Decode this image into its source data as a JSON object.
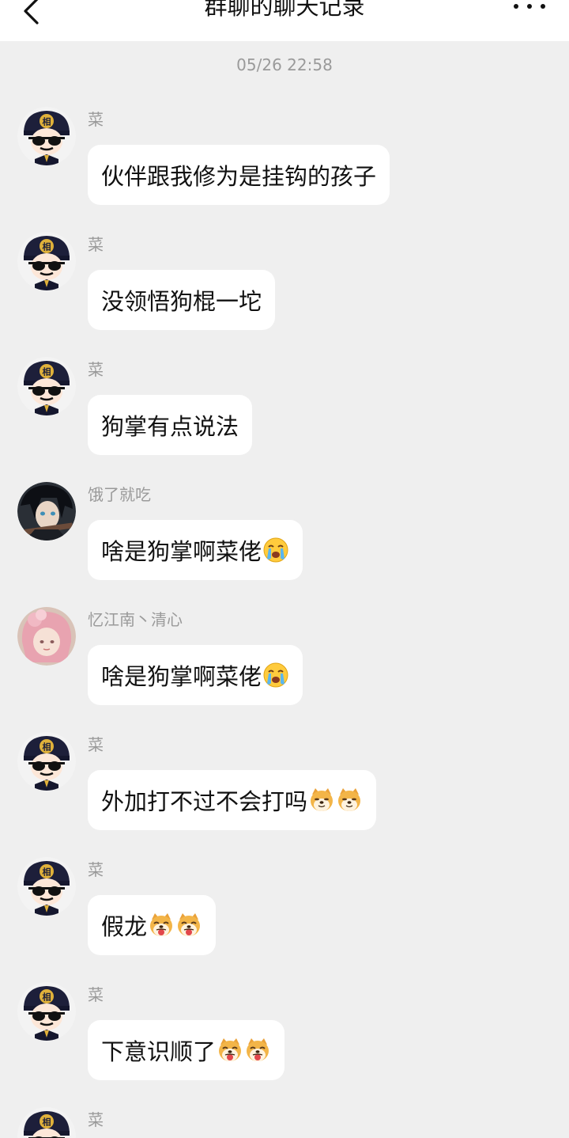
{
  "header": {
    "title": "群聊的聊天记录"
  },
  "timestamp": "05/26 22:58",
  "messages": [
    {
      "sender": "菜",
      "text": "伙伴跟我修为是挂钩的孩子",
      "avatar": "officer-avatar",
      "emojis": []
    },
    {
      "sender": "菜",
      "text": "没领悟狗棍一坨",
      "avatar": "officer-avatar",
      "emojis": []
    },
    {
      "sender": "菜",
      "text": "狗掌有点说法",
      "avatar": "officer-avatar",
      "emojis": []
    },
    {
      "sender": "饿了就吃",
      "text": "啥是狗掌啊菜佬",
      "avatar": "anime-dark-avatar",
      "emojis": [
        "crying-face-emoji"
      ]
    },
    {
      "sender": "忆江南丶清心",
      "text": "啥是狗掌啊菜佬",
      "avatar": "anime-pink-avatar",
      "emojis": [
        "crying-face-emoji"
      ]
    },
    {
      "sender": "菜",
      "text": "外加打不过不会打吗",
      "avatar": "officer-avatar",
      "emojis": [
        "doge-emoji",
        "doge-emoji"
      ]
    },
    {
      "sender": "菜",
      "text": "假龙",
      "avatar": "officer-avatar",
      "emojis": [
        "doge-tongue-emoji",
        "doge-tongue-emoji"
      ]
    },
    {
      "sender": "菜",
      "text": "下意识顺了",
      "avatar": "officer-avatar",
      "emojis": [
        "doge-tongue-emoji",
        "doge-tongue-emoji"
      ]
    },
    {
      "sender": "菜",
      "text": "",
      "avatar": "officer-avatar",
      "emojis": []
    }
  ],
  "colors": {
    "background": "#efefef",
    "bubble": "#ffffff",
    "meta_text": "#9a9a9a",
    "accent_gold": "#e0b13a"
  }
}
